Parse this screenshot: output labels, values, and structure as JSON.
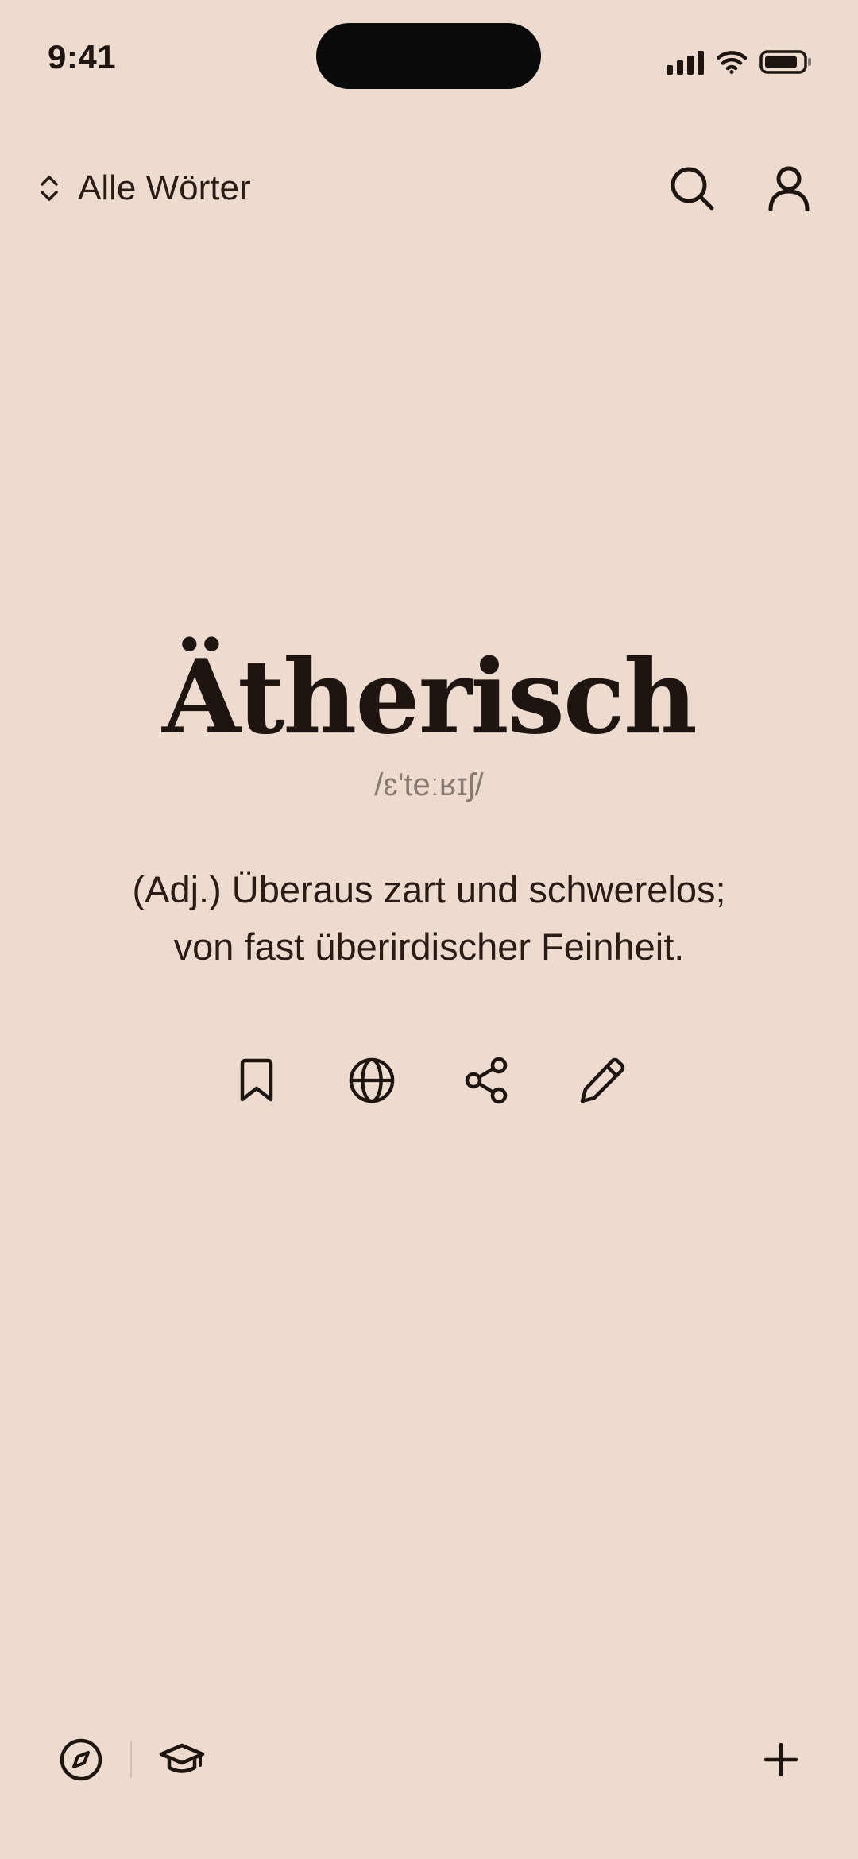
{
  "status": {
    "time": "9:41"
  },
  "header": {
    "title": "Alle Wörter"
  },
  "word": {
    "term": "Ätherisch",
    "ipa": "/ɛ'teːʁɪʃ/",
    "definition_line1": "(Adj.) Überaus zart und schwerelos;",
    "definition_line2": "von fast überirdischer Feinheit."
  },
  "icons": {
    "sort": "chevron-up-down-icon",
    "search": "search-icon",
    "profile": "user-icon",
    "bookmark": "bookmark-icon",
    "translate": "globe-icon",
    "share": "share-icon",
    "edit": "pencil-icon",
    "explore": "compass-icon",
    "learn": "graduation-cap-icon",
    "add": "plus-icon"
  },
  "colors": {
    "background": "#EEDBCF",
    "text": "#2A1C15",
    "secondary": "#8A7A71"
  }
}
